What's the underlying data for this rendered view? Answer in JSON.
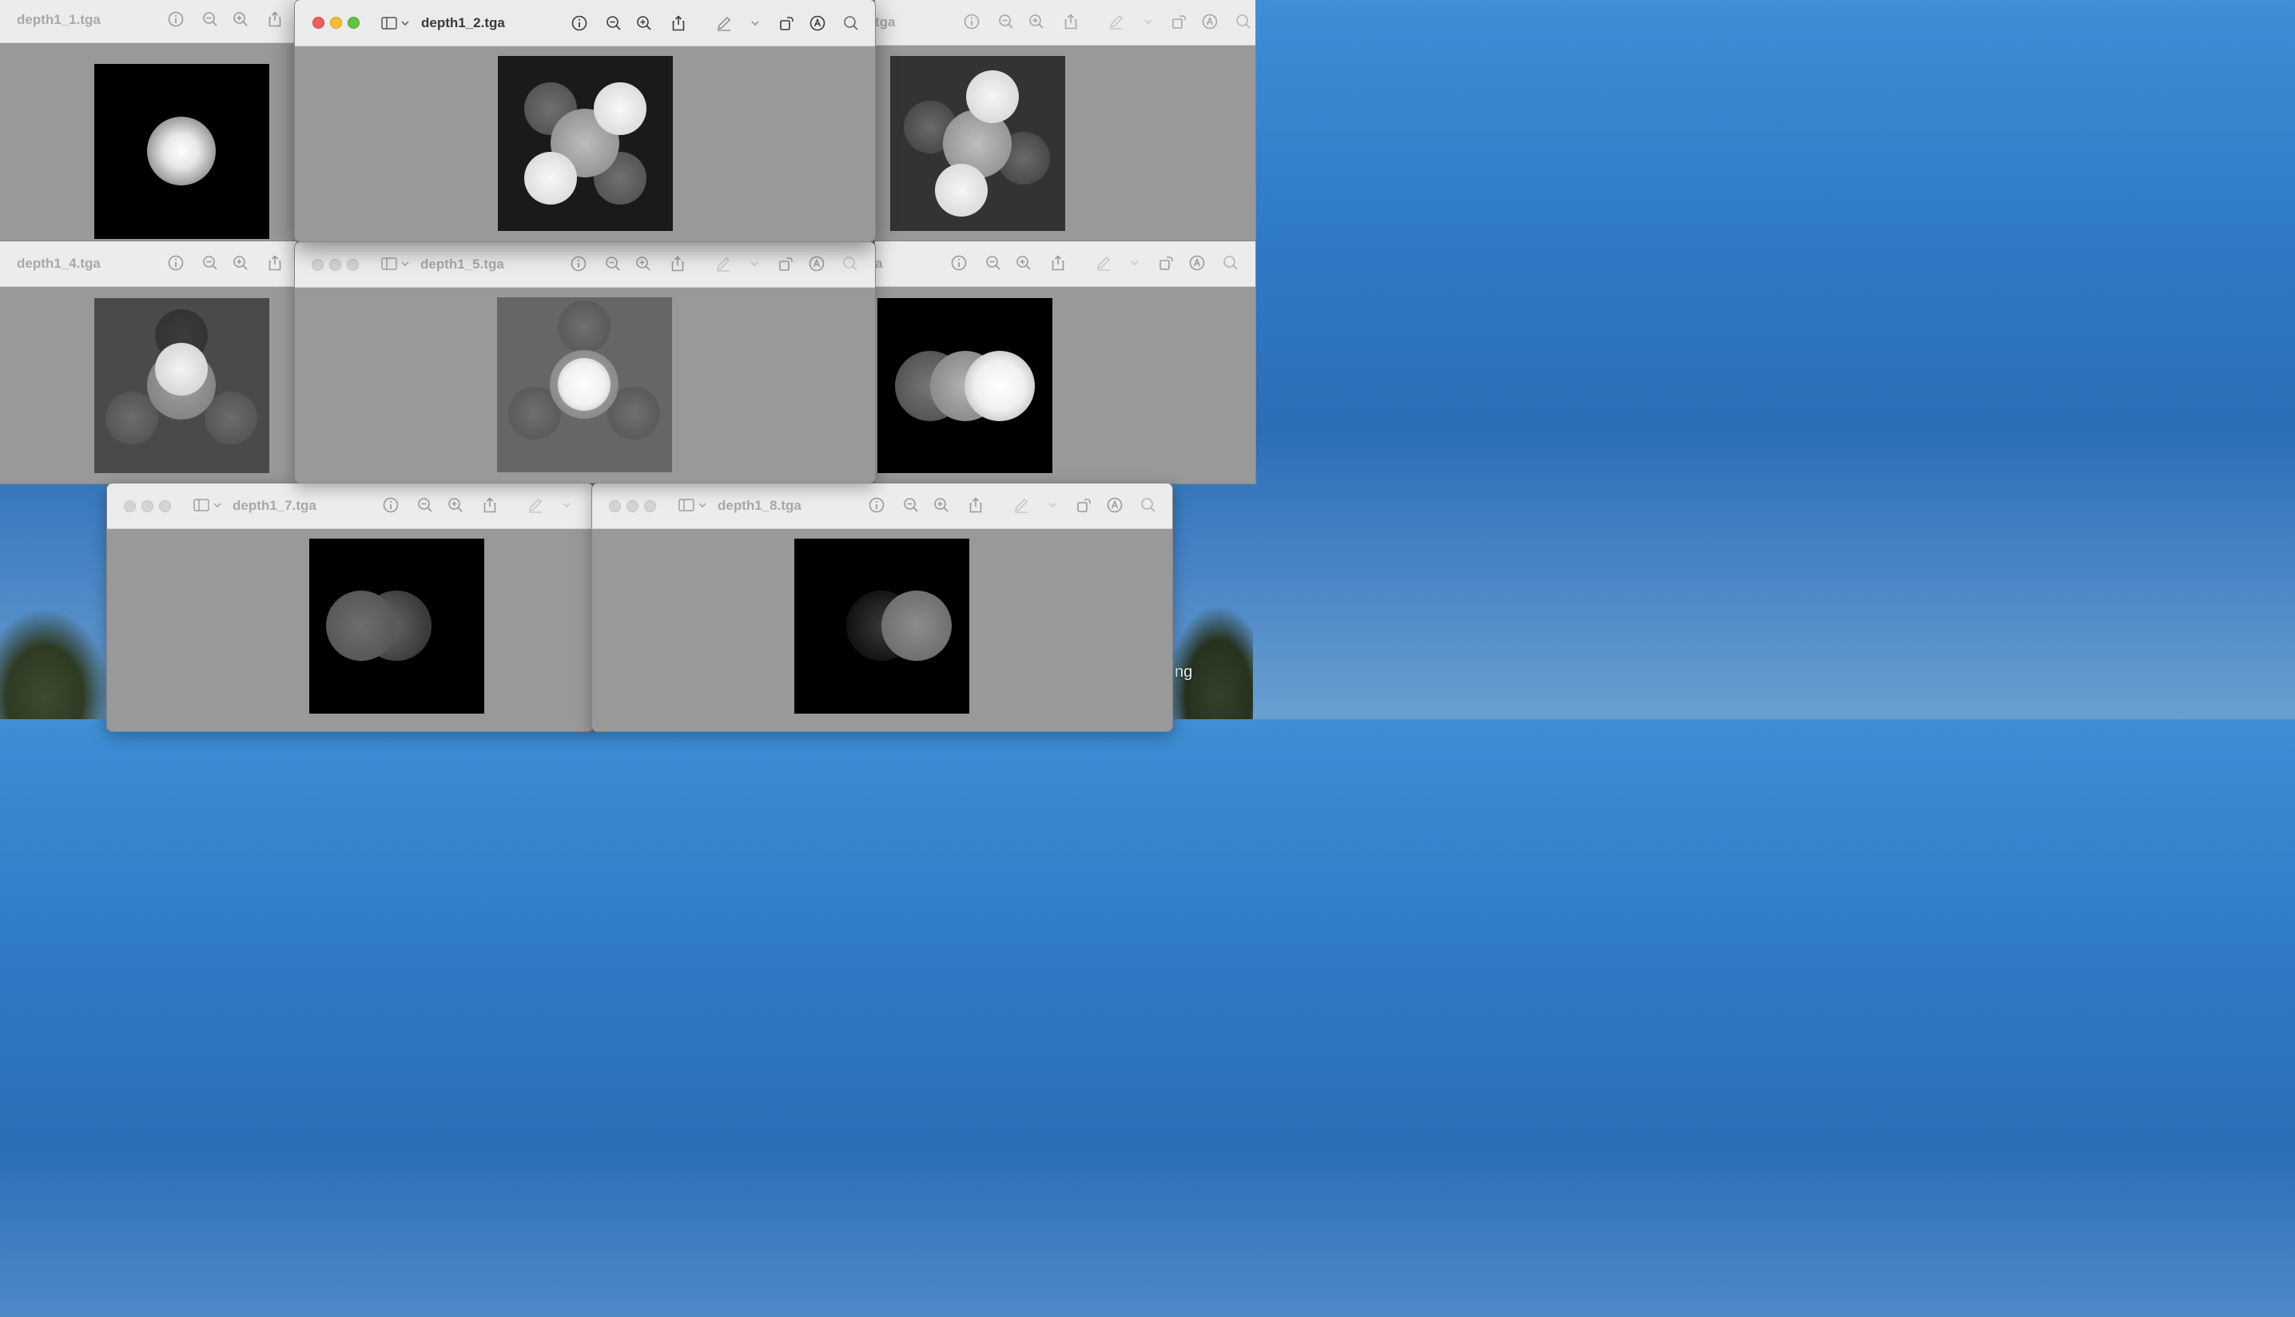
{
  "windows": [
    {
      "id": "w1",
      "title": "depth1_1.tga"
    },
    {
      "id": "w2",
      "title": "depth1_2.tga"
    },
    {
      "id": "w3",
      "title": "tga"
    },
    {
      "id": "w4",
      "title": "depth1_4.tga"
    },
    {
      "id": "w5",
      "title": "depth1_5.tga"
    },
    {
      "id": "w6",
      "title": "a"
    },
    {
      "id": "w7",
      "title": "depth1_7.tga"
    },
    {
      "id": "w8",
      "title": "depth1_8.tga"
    }
  ],
  "desktop": {
    "partial_label": "ng"
  },
  "toolbar_icons": [
    "sidebar-icon",
    "chevron-down-icon",
    "info-icon",
    "zoom-out-icon",
    "zoom-in-icon",
    "share-icon",
    "markup-icon",
    "rotate-icon",
    "annotate-icon",
    "search-icon"
  ],
  "colors": {
    "accent_red": "#ee5f57",
    "accent_yellow": "#f4bd2f",
    "accent_green": "#5fc53e",
    "window_bg": "#999999"
  }
}
